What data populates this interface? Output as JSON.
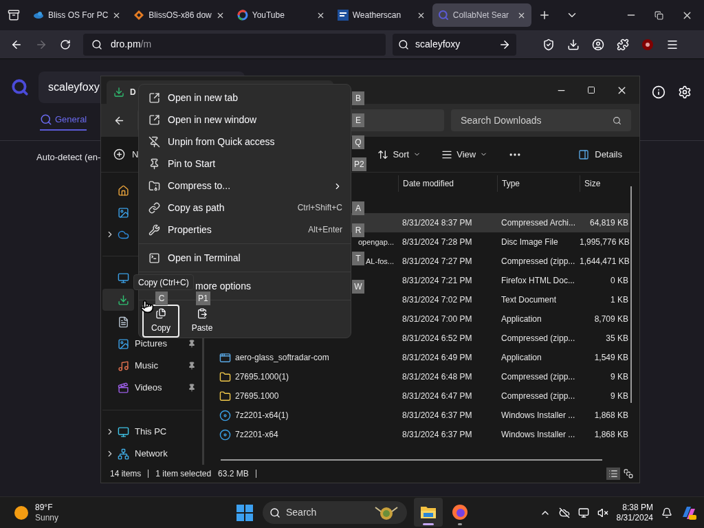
{
  "browser": {
    "tabs": [
      {
        "title": "Bliss OS For PC",
        "selected": false
      },
      {
        "title": "BlissOS-x86 dow",
        "selected": false
      },
      {
        "title": "YouTube",
        "selected": false
      },
      {
        "title": "Weatherscan",
        "selected": false
      },
      {
        "title": "CollabNet Sear",
        "selected": true
      }
    ],
    "url_host": "dro.pm",
    "url_path": "/m",
    "search_value": "scaleyfoxy"
  },
  "page": {
    "search_value": "scaleyfoxy",
    "tabs": [
      {
        "label": "General",
        "selected": true
      }
    ],
    "language": "Auto-detect (en-"
  },
  "explorer": {
    "tab_title": "D",
    "search_placeholder": "Search Downloads",
    "new_label": "N",
    "sort_label": "Sort",
    "view_label": "View",
    "details_label": "Details",
    "nav": {
      "top": [
        {
          "expandable": false,
          "selected": false
        },
        {
          "expandable": false,
          "selected": false
        },
        {
          "expandable": true,
          "selected": false
        }
      ],
      "quick_access": [
        {
          "selected": false
        },
        {
          "selected": true
        },
        {
          "selected": false
        },
        {
          "label": "Pictures",
          "selected": false,
          "pinned": true
        },
        {
          "label": "Music",
          "selected": false,
          "pinned": true
        },
        {
          "label": "Videos",
          "selected": false,
          "pinned": true
        }
      ],
      "devices": [
        {
          "label": "This PC",
          "expandable": true,
          "selected": false
        },
        {
          "label": "Network",
          "expandable": true,
          "selected": false
        }
      ]
    },
    "columns": [
      "Date modified",
      "Type",
      "Size"
    ],
    "rows": [
      {
        "date": "8/31/2024 8:37 PM",
        "type": "Compressed Archi...",
        "size": "64,819 KB",
        "selected": true
      },
      {
        "name_tail": "opengap...",
        "date": "8/31/2024 7:28 PM",
        "type": "Disc Image File",
        "size": "1,995,776 KB",
        "selected": false
      },
      {
        "name_tail": "AL-fos...",
        "date": "8/31/2024 7:27 PM",
        "type": "Compressed (zipp...",
        "size": "1,644,471 KB",
        "selected": false
      },
      {
        "date": "8/31/2024 7:21 PM",
        "type": "Firefox HTML Doc...",
        "size": "0 KB",
        "selected": false
      },
      {
        "date": "8/31/2024 7:02 PM",
        "type": "Text Document",
        "size": "1 KB",
        "selected": false
      },
      {
        "date": "8/31/2024 7:00 PM",
        "type": "Application",
        "size": "8,709 KB",
        "selected": false
      },
      {
        "date": "8/31/2024 6:52 PM",
        "type": "Compressed (zipp...",
        "size": "35 KB",
        "selected": false
      },
      {
        "kind": "application",
        "name": "aero-glass_softradar-com",
        "date": "8/31/2024 6:49 PM",
        "type": "Application",
        "size": "1,549 KB",
        "selected": false
      },
      {
        "kind": "zip",
        "name": "27695.1000(1)",
        "date": "8/31/2024 6:48 PM",
        "type": "Compressed (zipp...",
        "size": "9 KB",
        "selected": false
      },
      {
        "kind": "zip",
        "name": "27695.1000",
        "date": "8/31/2024 6:47 PM",
        "type": "Compressed (zipp...",
        "size": "9 KB",
        "selected": false
      },
      {
        "kind": "installer",
        "name": "7z2201-x64(1)",
        "date": "8/31/2024 6:37 PM",
        "type": "Windows Installer ...",
        "size": "1,868 KB",
        "selected": false
      },
      {
        "kind": "installer",
        "name": "7z2201-x64",
        "date": "8/31/2024 6:37 PM",
        "type": "Windows Installer ...",
        "size": "1,868 KB",
        "selected": false
      }
    ],
    "status": [
      "14 items",
      "1 item selected",
      "63.2 MB"
    ],
    "views": [
      {
        "selected": true
      },
      {
        "selected": false
      }
    ]
  },
  "context_menu": {
    "items": [
      {
        "label": "Open in new tab",
        "key": "B"
      },
      {
        "label": "Open in new window",
        "key": "E"
      },
      {
        "label": "Unpin from Quick access",
        "key": "Q"
      },
      {
        "label": "Pin to Start",
        "key": "P2"
      },
      {
        "label": "Compress to...",
        "submenu": true
      },
      {
        "label": "Copy as path",
        "shortcut": "Ctrl+Shift+C",
        "key": "A"
      },
      {
        "label": "Properties",
        "shortcut": "Alt+Enter",
        "key": "R"
      },
      {
        "kind": "separator"
      },
      {
        "label": "Open in Terminal",
        "key": "T"
      },
      {
        "kind": "separator"
      },
      {
        "kind": "covered",
        "label": "more options",
        "key": "W"
      },
      {
        "kind": "separator"
      }
    ],
    "actions": [
      {
        "label": "Copy",
        "key": "C",
        "selected": true
      },
      {
        "label": "Paste",
        "key": "P1",
        "selected": false
      }
    ],
    "tooltip": "Copy (Ctrl+C)"
  },
  "taskbar": {
    "temperature": "89°F",
    "condition": "Sunny",
    "search_placeholder": "Search",
    "time": "8:38 PM",
    "date": "8/31/2024",
    "apps": [
      {
        "active": true
      },
      {
        "active": false
      }
    ]
  }
}
